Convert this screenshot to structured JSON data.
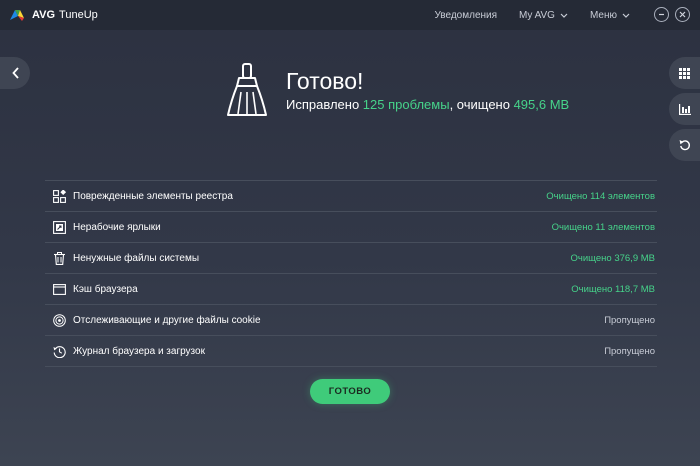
{
  "app": {
    "brand": "AVG",
    "product": "TuneUp"
  },
  "nav": {
    "notifications": "Уведомления",
    "my_avg": "My AVG",
    "menu": "Меню"
  },
  "summary": {
    "title": "Готово!",
    "fixed_prefix": "Исправлено ",
    "fixed_value": "125 проблемы",
    "cleaned_prefix": ", очищено ",
    "cleaned_value": "495,6 MB"
  },
  "items": [
    {
      "label": "Поврежденные элементы реестра",
      "status": "Очищено 114 элементов",
      "state": "done",
      "icon": "registry-icon"
    },
    {
      "label": "Нерабочие ярлыки",
      "status": "Очищено 11 элементов",
      "state": "done",
      "icon": "shortcut-icon"
    },
    {
      "label": "Ненужные файлы системы",
      "status": "Очищено 376,9 MB",
      "state": "done",
      "icon": "trash-icon"
    },
    {
      "label": "Кэш браузера",
      "status": "Очищено 118,7 MB",
      "state": "done",
      "icon": "browser-window-icon"
    },
    {
      "label": "Отслеживающие и другие файлы cookie",
      "status": "Пропущено",
      "state": "skipped",
      "icon": "target-icon"
    },
    {
      "label": "Журнал браузера и загрузок",
      "status": "Пропущено",
      "state": "skipped",
      "icon": "history-clock-icon"
    }
  ],
  "done_button": "ГОТОВО",
  "colors": {
    "accent_green": "#46d38a",
    "button_green": "#3fcb7a",
    "background": "#323848",
    "titlebar": "#252a36"
  },
  "side_icons": [
    "grid-icon",
    "chart-icon",
    "refresh-icon"
  ]
}
